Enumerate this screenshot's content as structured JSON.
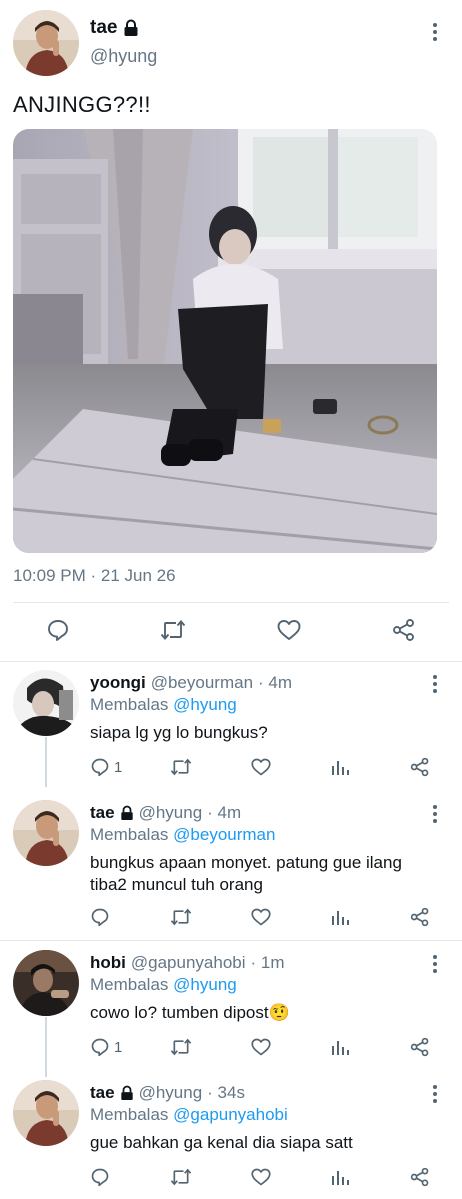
{
  "main_tweet": {
    "name": "tae",
    "handle": "@hyung",
    "text": "ANJINGG??!!",
    "timestamp": "10:09 PM · 21 Jun 26",
    "icons": [
      "more-vertical-icon",
      "lock-icon",
      "reply-icon",
      "retweet-icon",
      "like-icon",
      "share-icon"
    ]
  },
  "replies": [
    {
      "name": "yoongi",
      "handle": "@beyourman",
      "time": "· 4m",
      "replying_label": "Membalas",
      "replying_to": "@hyung",
      "text": "siapa lg yg lo bungkus?",
      "reply_count": "1",
      "locked": false
    },
    {
      "name": "tae",
      "handle": "@hyung",
      "time": "· 4m",
      "replying_label": "Membalas",
      "replying_to": "@beyourman",
      "text": "bungkus apaan monyet. patung gue ilang tiba2 muncul tuh orang",
      "reply_count": "",
      "locked": true
    },
    {
      "name": "hobi",
      "handle": "@gapunyahobi",
      "time": "· 1m",
      "replying_label": "Membalas",
      "replying_to": "@hyung",
      "text": "cowo lo? tumben dipost🤨",
      "reply_count": "1",
      "locked": false
    },
    {
      "name": "tae",
      "handle": "@hyung",
      "time": "· 34s",
      "replying_label": "Membalas",
      "replying_to": "@gapunyahobi",
      "text": "gue bahkan ga kenal dia siapa satt",
      "reply_count": "",
      "locked": true
    }
  ],
  "colors": {
    "link": "#1d9bf0",
    "muted": "#657786",
    "divider": "#e1e8ed"
  }
}
